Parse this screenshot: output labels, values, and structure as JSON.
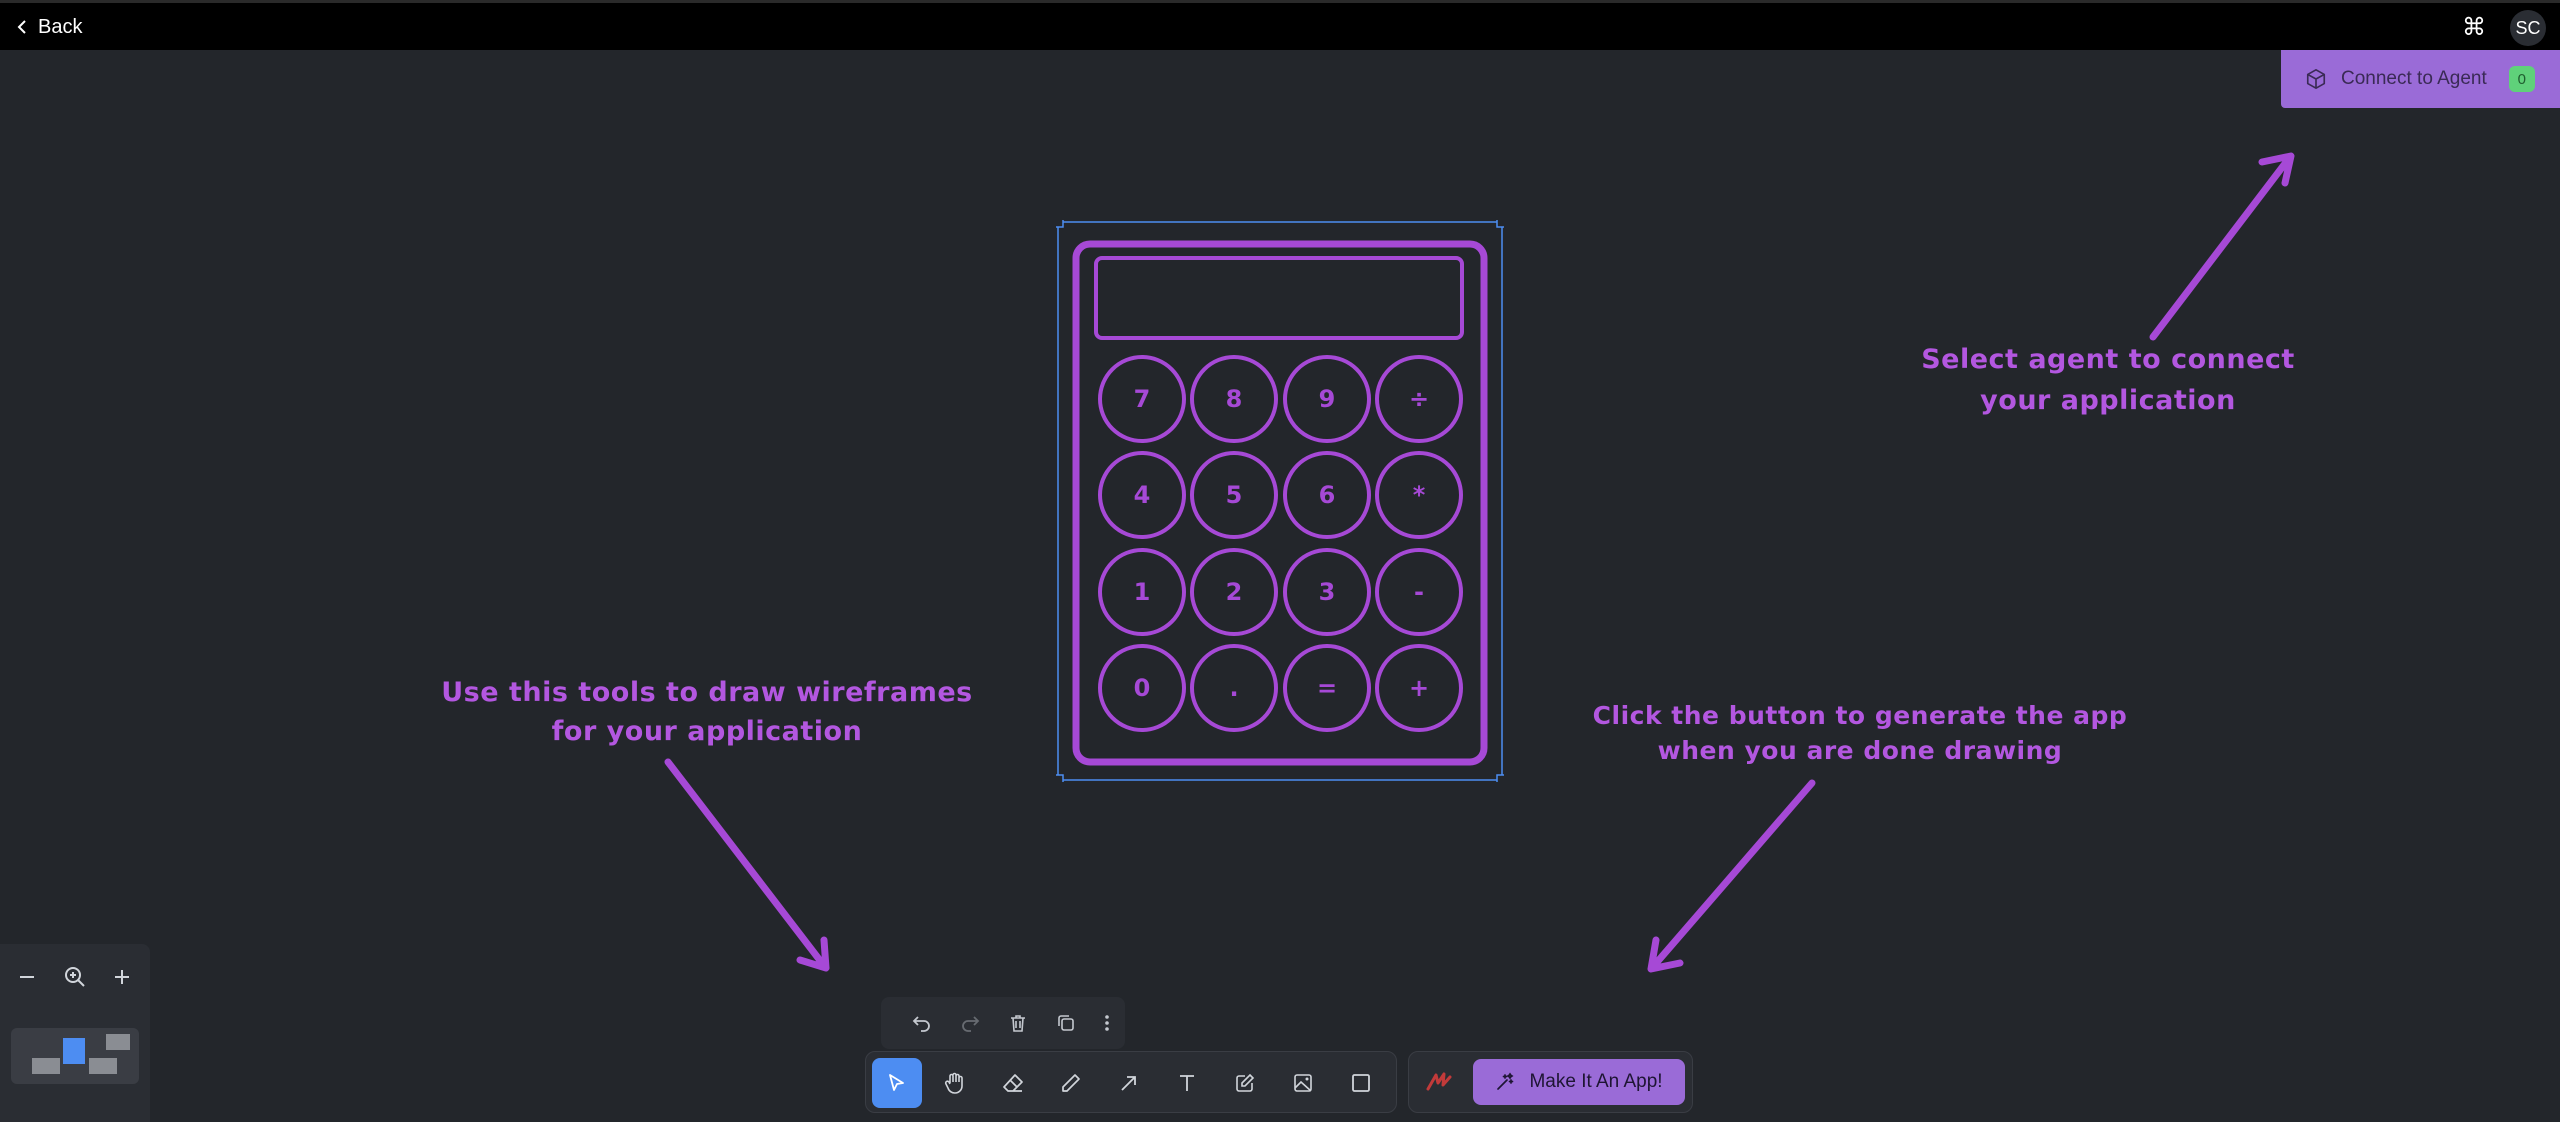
{
  "topbar": {
    "back_label": "Back",
    "command_symbol": "⌘",
    "avatar_initials": "SC"
  },
  "connect_agent": {
    "label": "Connect to Agent",
    "count": "0"
  },
  "annotations": {
    "agent_line1": "Select agent to connect",
    "agent_line2": "your application",
    "tools_line1": "Use this tools to draw wireframes",
    "tools_line2": "for your application",
    "generate_line1": "Click the button to generate the app",
    "generate_line2": "when you are done drawing"
  },
  "calculator": {
    "keys": [
      "7",
      "8",
      "9",
      "÷",
      "4",
      "5",
      "6",
      "*",
      "1",
      "2",
      "3",
      "-",
      "0",
      ".",
      "=",
      "+"
    ]
  },
  "toolbar": {
    "make_app_label": "Make It An App!"
  },
  "colors": {
    "accent": "#9a6bd7",
    "annotation": "#b357e0",
    "selection": "#4d8df2",
    "badge": "#5fd17a"
  },
  "icons": {
    "tools": [
      "cursor-icon",
      "hand-icon",
      "eraser-icon",
      "pencil-icon",
      "arrow-icon",
      "text-icon",
      "note-icon",
      "image-icon",
      "rectangle-icon"
    ],
    "history": [
      "undo-icon",
      "redo-icon",
      "trash-icon",
      "duplicate-icon",
      "more-icon"
    ]
  }
}
